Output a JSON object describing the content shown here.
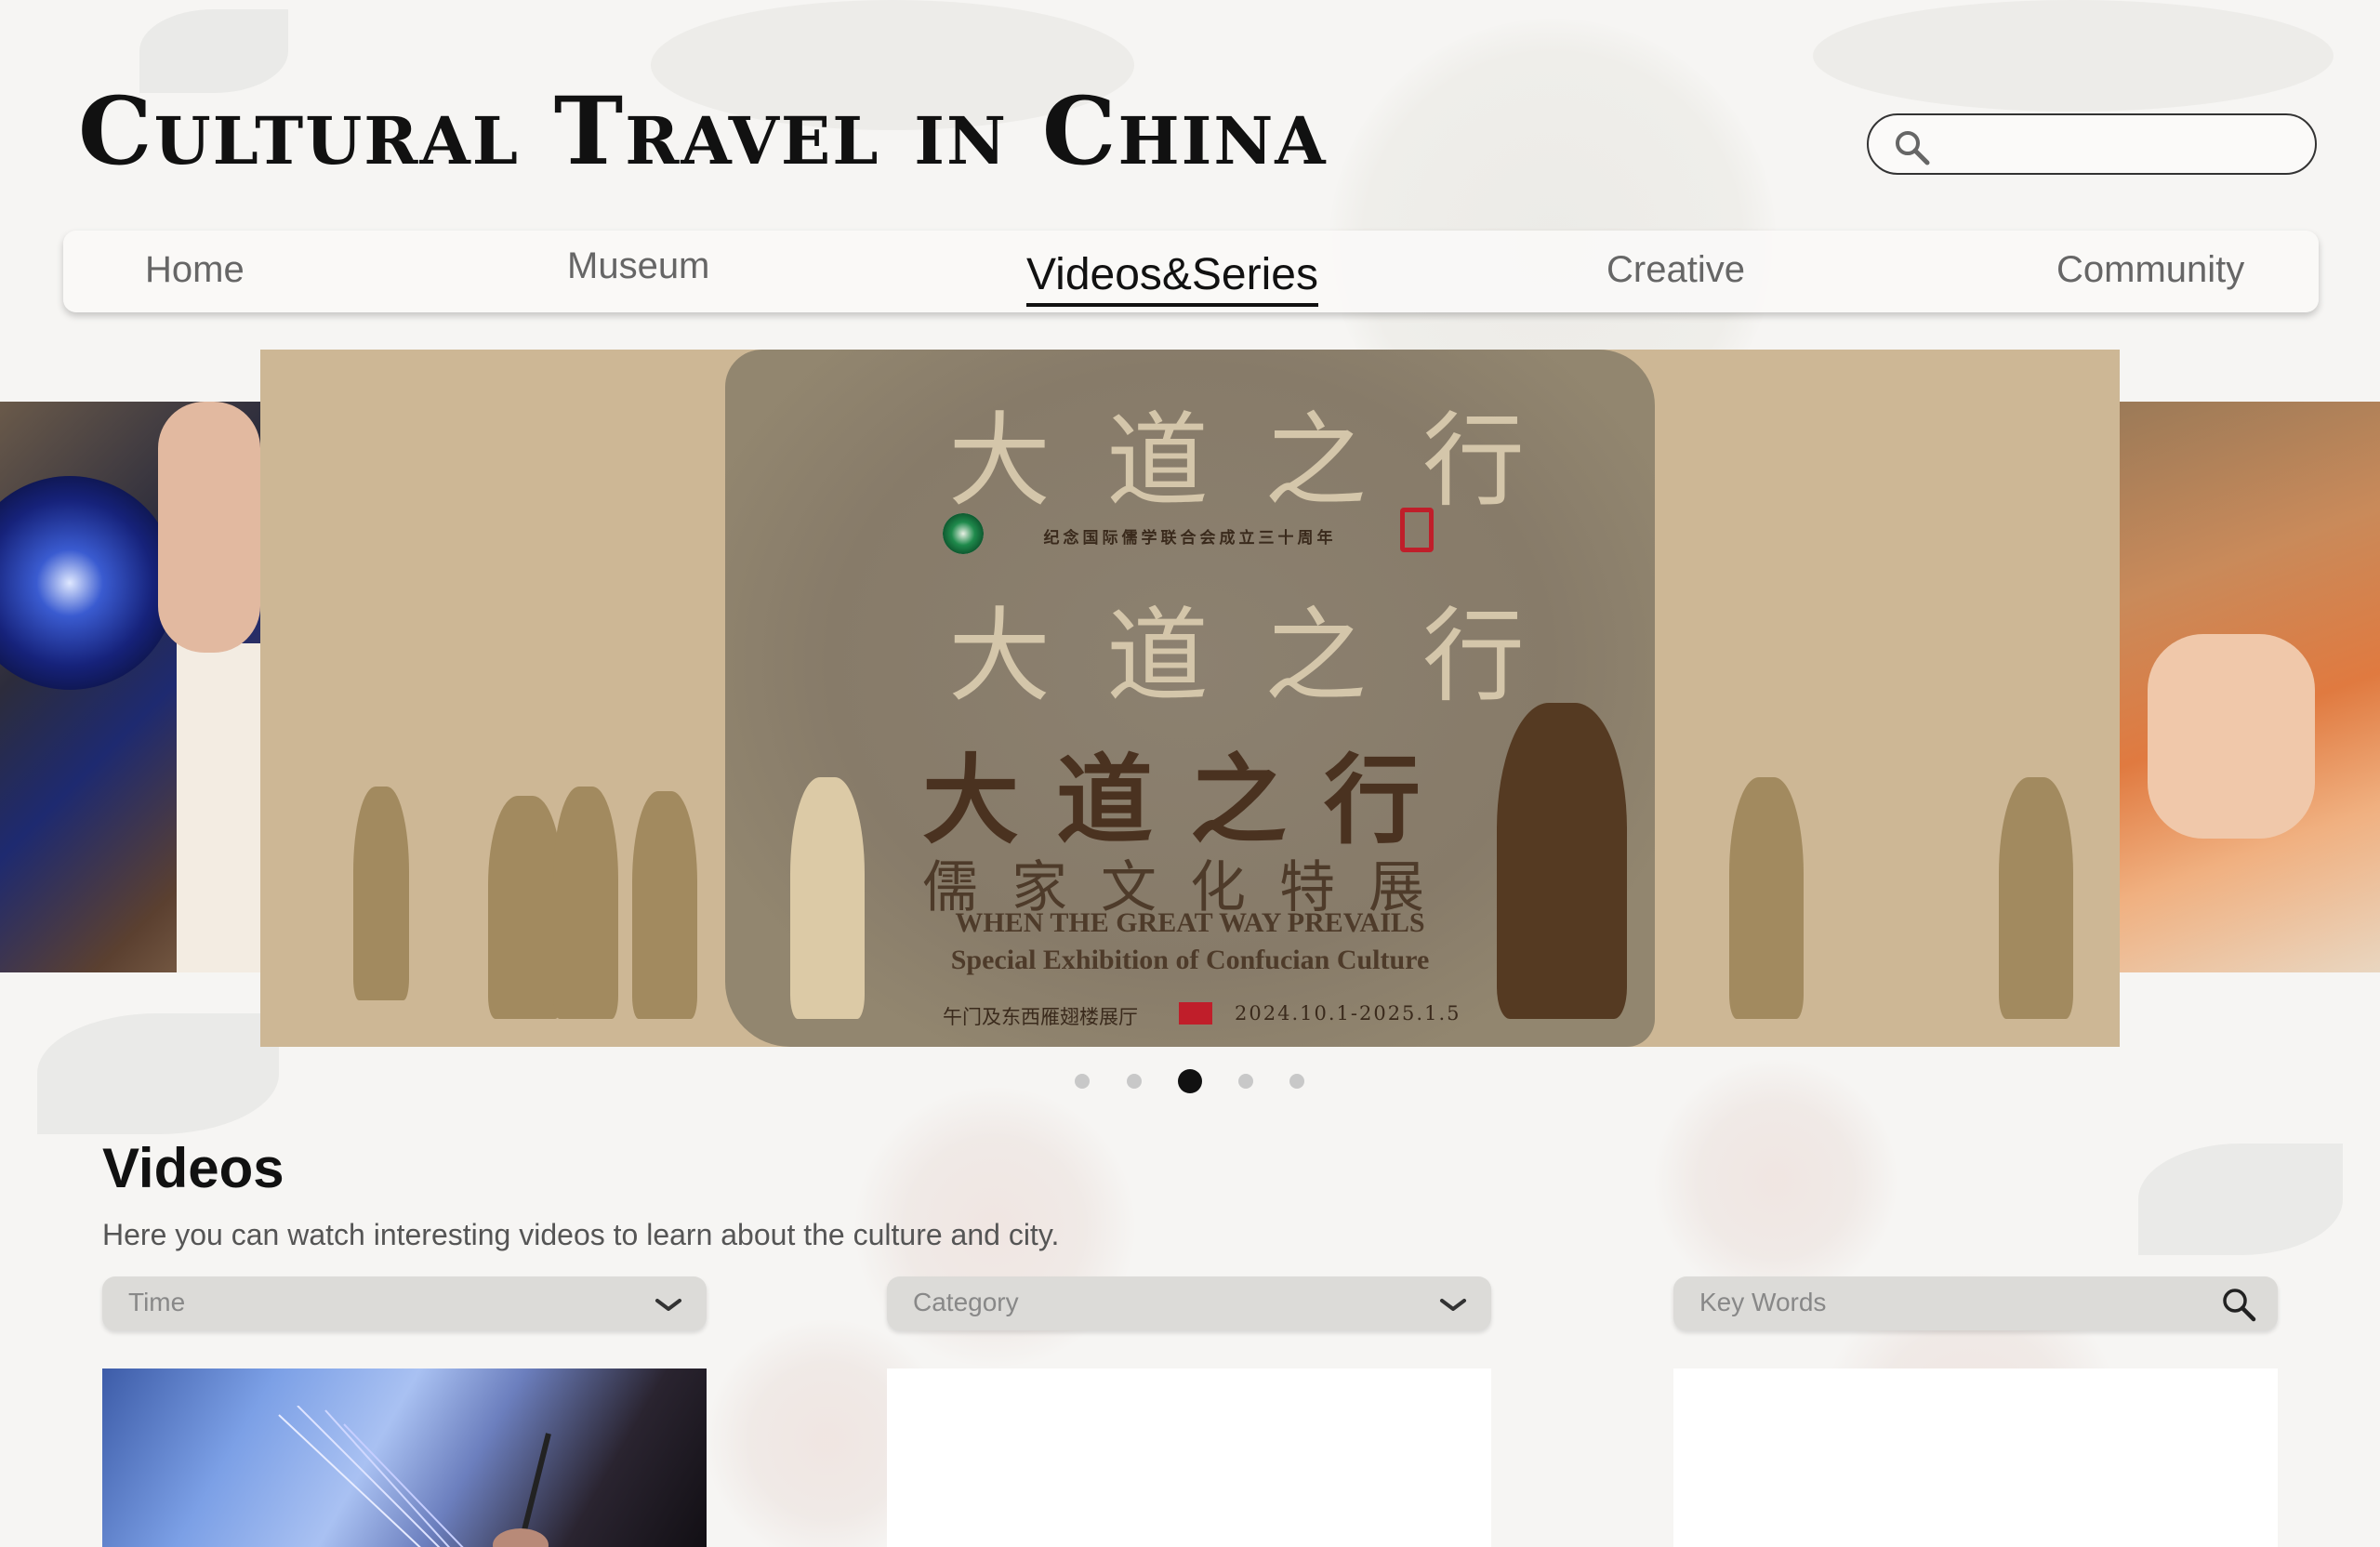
{
  "site": {
    "title": "Cultural Travel in China"
  },
  "search": {
    "placeholder": "",
    "icon": "search-icon"
  },
  "nav": {
    "items": [
      {
        "label": "Home"
      },
      {
        "label": "Museum"
      },
      {
        "label": "Videos&Series",
        "active": true
      },
      {
        "label": "Creative"
      },
      {
        "label": "Community"
      }
    ]
  },
  "carousel": {
    "slides_count": 5,
    "active_index": 2,
    "main_slide": {
      "cn_top_line": "纪念国际儒学联合会成立三十周年",
      "cn_title": "大道之行",
      "cn_subtitle": "儒家文化特展",
      "en_title": "WHEN THE GREAT WAY PREVAILS",
      "en_subtitle": "Special Exhibition of Confucian Culture",
      "venue": "午门及东西雁翅楼展厅",
      "dates": "2024.10.1-2025.1.5",
      "seal_line_1": "大道之行",
      "seal_line_2": "大道之行"
    }
  },
  "videos": {
    "title": "Videos",
    "description": "Here you can watch interesting videos to learn about the culture and city.",
    "filters": {
      "time": {
        "label": "Time"
      },
      "category": {
        "label": "Category"
      },
      "keywords": {
        "label": "Key Words"
      }
    }
  },
  "colors": {
    "accent": "#111111",
    "nav_inactive": "#666666",
    "poster_bg": "#cdb795",
    "filter_bg": "#dcdbd8"
  }
}
